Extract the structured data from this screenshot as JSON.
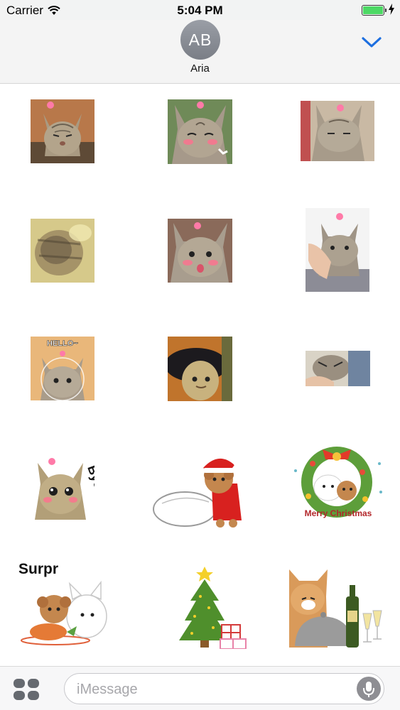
{
  "status_bar": {
    "carrier": "Carrier",
    "time": "5:04 PM",
    "battery_level": 1.0
  },
  "header": {
    "avatar_initials": "AB",
    "contact_name": "Aria",
    "collapse_icon": "chevron-down-icon"
  },
  "sticker_texts": {
    "hello": "HELLO~",
    "bye": "Bye!",
    "merry_christmas": "Merry Christmas",
    "surprise": "Surpr"
  },
  "composer": {
    "placeholder": "iMessage",
    "apps_icon": "app-drawer-icon",
    "mic_icon": "microphone-icon"
  },
  "colors": {
    "accent": "#1d6fe0",
    "battery": "#4cd964",
    "avatar": "#8a8e96"
  }
}
